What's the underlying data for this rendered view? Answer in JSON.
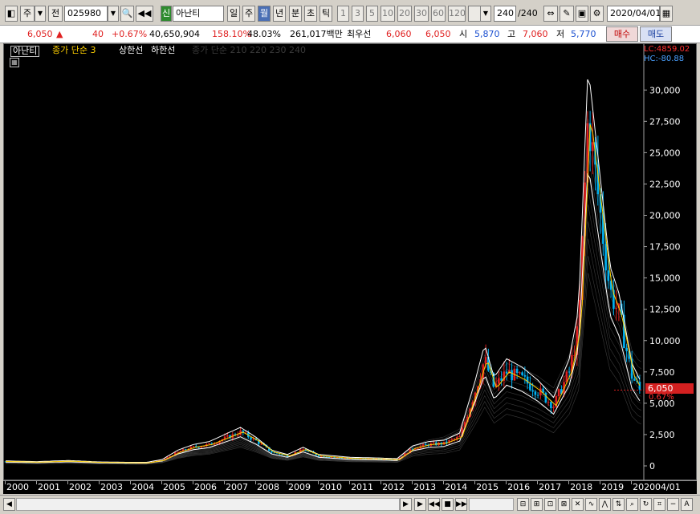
{
  "toolbar": {
    "market": "주",
    "jeon": "전",
    "code": "025980",
    "sin_badge": "신",
    "stock_name": "아난티",
    "periods": [
      {
        "label": "일",
        "active": false
      },
      {
        "label": "주",
        "active": false
      },
      {
        "label": "월",
        "active": true
      },
      {
        "label": "년",
        "active": false
      },
      {
        "label": "분",
        "active": false
      },
      {
        "label": "초",
        "active": false
      },
      {
        "label": "틱",
        "active": false
      }
    ],
    "intervals": [
      "1",
      "3",
      "5",
      "10",
      "20",
      "30",
      "60",
      "120"
    ],
    "count_value": "240",
    "count_total": "/240",
    "date": "2020/04/01"
  },
  "quote": {
    "price": "6,050",
    "arrow": "▲",
    "change": "40",
    "change_pct": "+0.67%",
    "volume": "40,650,904",
    "vol_ratio": "158.10%",
    "turnover": "48.03%",
    "amount": "261,017백만",
    "best_label": "최우선",
    "best_bid": "6,060",
    "best_ask": "6,050",
    "open_label": "시",
    "open": "5,870",
    "high_label": "고",
    "high": "7,060",
    "low_label": "저",
    "low": "5,770",
    "buy_label": "매수",
    "sell_label": "매도"
  },
  "legend": {
    "name": "아난티",
    "ma_label": "종가 단순 3",
    "upper": "상한선",
    "lower": "하한선",
    "ma_dim": "종가 단순 210  220  230  240"
  },
  "indicators": {
    "lc": "LC:4859.02",
    "hc": "HC:-80.88"
  },
  "price_tag": "6,050",
  "pct_tag": "0.67%",
  "x_date_label": "04/01",
  "colors": {
    "up": "#e02020",
    "down": "#00b0f0",
    "ma": "#ffd000",
    "band": "#ffffff",
    "tag": "#d42020"
  },
  "chart_data": {
    "type": "candlestick",
    "y_ticks": [
      "30,000",
      "27,500",
      "25,000",
      "22,500",
      "20,000",
      "17,500",
      "15,000",
      "12,500",
      "10,000",
      "7,500",
      "5,000",
      "2,500",
      "0"
    ],
    "ylim": [
      0,
      32000
    ],
    "x_years": [
      "2000",
      "2001",
      "2002",
      "2003",
      "2004",
      "2005",
      "2006",
      "2007",
      "2008",
      "2009",
      "2010",
      "2011",
      "2012",
      "2013",
      "2014",
      "2015",
      "2016",
      "2017",
      "2018",
      "2019",
      "2020"
    ],
    "series": [
      {
        "name": "close",
        "x": [
          2000.0,
          2001.0,
          2002.0,
          2003.0,
          2004.0,
          2004.5,
          2005.0,
          2005.5,
          2006.0,
          2006.5,
          2007.0,
          2007.5,
          2008.0,
          2008.5,
          2009.0,
          2009.5,
          2010.0,
          2011.0,
          2012.0,
          2012.5,
          2013.0,
          2013.5,
          2014.0,
          2014.5,
          2015.0,
          2015.3,
          2015.6,
          2016.0,
          2016.5,
          2017.0,
          2017.5,
          2018.0,
          2018.3,
          2018.6,
          2019.0,
          2019.3,
          2019.6,
          2020.0,
          2020.25
        ],
        "y": [
          350,
          300,
          380,
          280,
          250,
          250,
          450,
          1100,
          1500,
          1700,
          2200,
          2700,
          2000,
          1100,
          800,
          1300,
          800,
          600,
          550,
          500,
          1400,
          1700,
          1800,
          2300,
          6000,
          8500,
          6200,
          7500,
          6900,
          6000,
          4800,
          7500,
          11000,
          28000,
          20000,
          14000,
          12000,
          7200,
          6050
        ]
      }
    ]
  }
}
